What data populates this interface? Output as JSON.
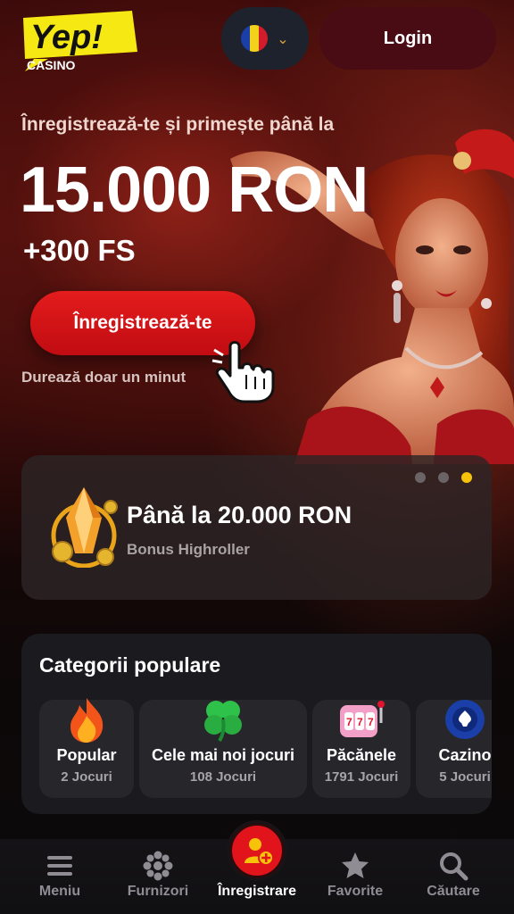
{
  "header": {
    "logo_text": "Yep!",
    "logo_subtext": "CASINO",
    "language_flag_icon": "flag-romania-icon",
    "login_label": "Login"
  },
  "hero": {
    "subtitle": "Înregistrează-te și primește până la",
    "amount": "15.000 RON",
    "free_spins": "+300 FS",
    "cta_label": "Înregistrează-te",
    "note": "Durează doar un minut"
  },
  "promo": {
    "title": "Până la 20.000 RON",
    "subtitle": "Bonus Highroller",
    "dots_total": 3,
    "active_dot": 3
  },
  "categories": {
    "title": "Categorii populare",
    "items": [
      {
        "name": "Popular",
        "count": "2 Jocuri",
        "icon": "fire-icon"
      },
      {
        "name": "Cele mai noi jocuri",
        "count": "108 Jocuri",
        "icon": "clover-icon"
      },
      {
        "name": "Păcănele",
        "count": "1791 Jocuri",
        "icon": "slot-machine-icon"
      },
      {
        "name": "Cazino",
        "count": "5 Jocuri",
        "icon": "poker-chip-icon"
      }
    ]
  },
  "bottom_nav": {
    "items": [
      {
        "label": "Meniu",
        "icon": "menu-icon"
      },
      {
        "label": "Furnizori",
        "icon": "providers-icon"
      },
      {
        "label": "Înregistrare",
        "icon": "add-user-icon"
      },
      {
        "label": "Favorite",
        "icon": "star-icon"
      },
      {
        "label": "Căutare",
        "icon": "search-icon"
      }
    ]
  },
  "colors": {
    "accent_red": "#e41c1c",
    "accent_yellow": "#f6c30a",
    "login_bg": "#4a0c14",
    "card_bg": "#1b1a1e"
  }
}
